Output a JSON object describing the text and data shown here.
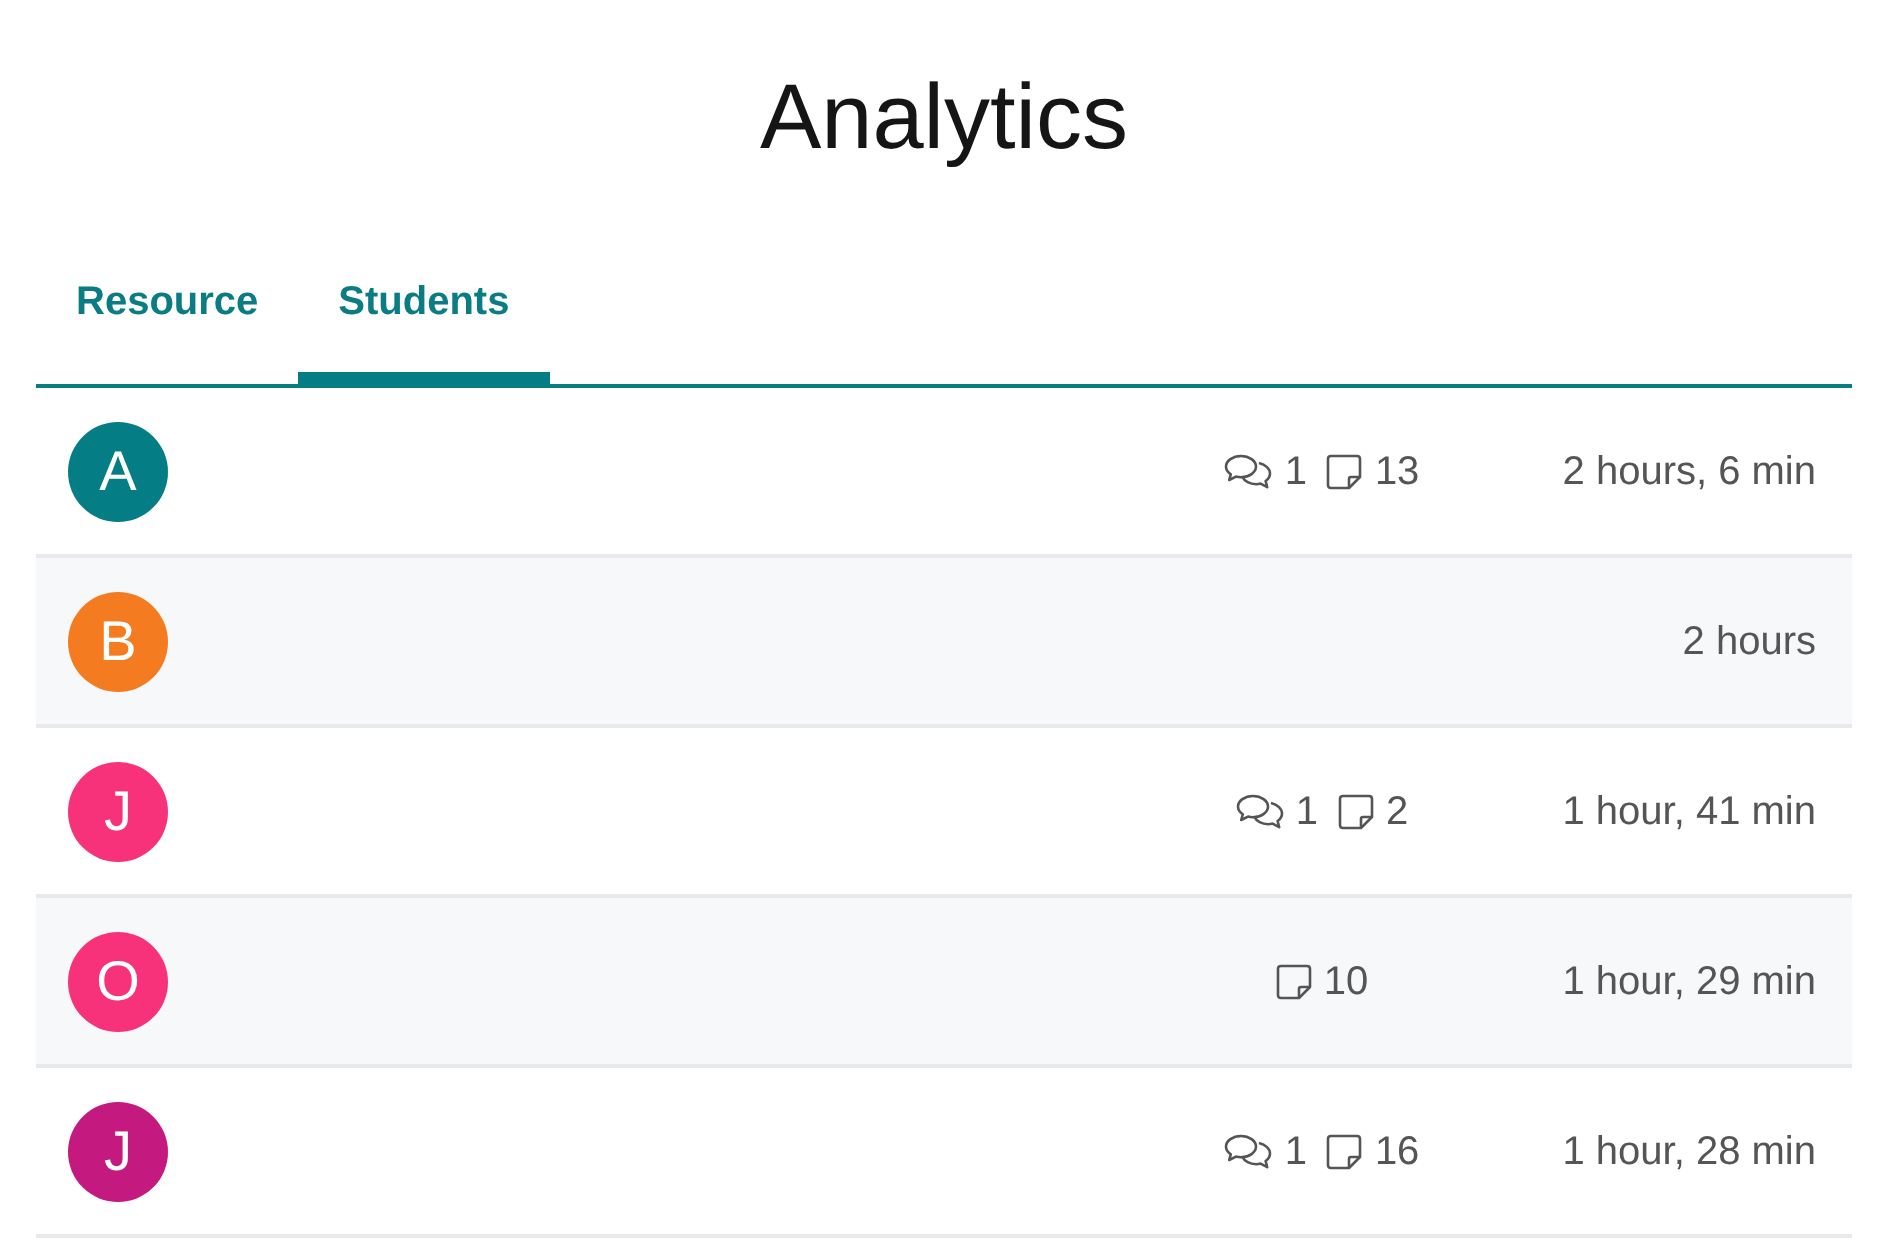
{
  "title": "Analytics",
  "tabs": [
    {
      "label": "Resource",
      "selected": false
    },
    {
      "label": "Students",
      "selected": true
    }
  ],
  "rows": [
    {
      "initial": "A",
      "color": "#047d84",
      "stats": [
        {
          "kind": "comments",
          "count": "1"
        },
        {
          "kind": "notes",
          "count": "13"
        }
      ],
      "time": "2 hours, 6 min"
    },
    {
      "initial": "B",
      "color": "#f47b20",
      "stats": [],
      "time": "2 hours"
    },
    {
      "initial": "J",
      "color": "#f7327a",
      "stats": [
        {
          "kind": "comments",
          "count": "1"
        },
        {
          "kind": "notes",
          "count": "2"
        }
      ],
      "time": "1 hour, 41 min"
    },
    {
      "initial": "O",
      "color": "#f7327a",
      "stats": [
        {
          "kind": "notes",
          "count": "10"
        }
      ],
      "time": "1 hour, 29 min"
    },
    {
      "initial": "J",
      "color": "#c4197f",
      "stats": [
        {
          "kind": "comments",
          "count": "1"
        },
        {
          "kind": "notes",
          "count": "16"
        }
      ],
      "time": "1 hour, 28 min"
    }
  ]
}
